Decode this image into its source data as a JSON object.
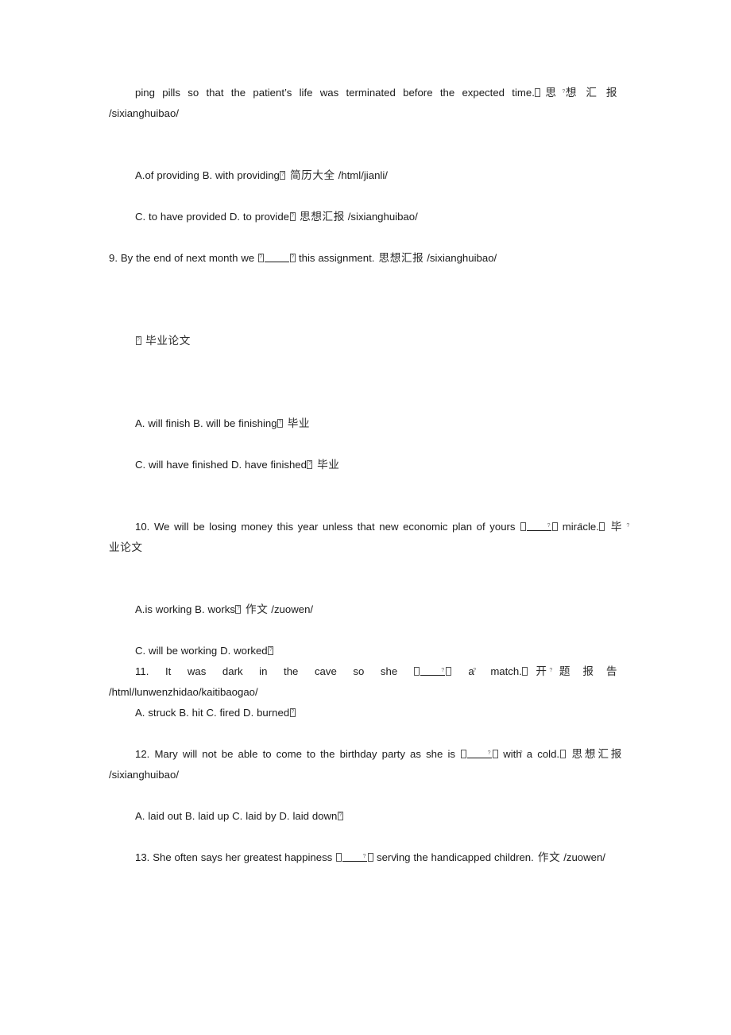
{
  "document": {
    "type": "exam-worksheet",
    "language": "English grammar multiple choice with Chinese watermark links",
    "background_color": "#ffffff",
    "text_color": "#1a1a1a",
    "cjk_color": "#2b2b2b"
  },
  "blocks": [
    {
      "id": "b1",
      "kind": "continuation",
      "indent": true,
      "justify": "hard",
      "runs": [
        {
          "t": "text",
          "v": "ping pills so that the patient’s life was terminated before the expected time."
        },
        {
          "t": "tofu"
        },
        {
          "t": "cjk",
          "v": "思想汇报",
          "wide": true
        },
        {
          "t": "text",
          "v": " /sixianghuibao/"
        }
      ]
    },
    {
      "id": "b2",
      "kind": "options",
      "runs": [
        {
          "t": "text",
          "v": "A.of providing B. with providing"
        },
        {
          "t": "tofu"
        },
        {
          "t": "cjk",
          "v": " 简历大全"
        },
        {
          "t": "text",
          "v": "  /html/jianli/"
        }
      ]
    },
    {
      "id": "b3",
      "kind": "options",
      "runs": [
        {
          "t": "text",
          "v": "C. to have provided D. to provide"
        },
        {
          "t": "tofu"
        },
        {
          "t": "cjk",
          "v": " 思想汇报"
        },
        {
          "t": "text",
          "v": "  /sixianghuibao/"
        }
      ]
    },
    {
      "id": "b4",
      "kind": "question",
      "number": "9",
      "runs": [
        {
          "t": "text",
          "v": "9. By the end of next month we "
        },
        {
          "t": "blank"
        },
        {
          "t": "text",
          "v": " this assignment."
        },
        {
          "t": "cjk",
          "v": "  思想汇报"
        },
        {
          "t": "text",
          "v": "  /sixianghuibao/"
        }
      ]
    },
    {
      "id": "b5",
      "kind": "watermark",
      "runs": [
        {
          "t": "tofu"
        },
        {
          "t": "cjk",
          "v": " 毕业论文"
        }
      ]
    },
    {
      "id": "b6",
      "kind": "options",
      "runs": [
        {
          "t": "text",
          "v": "A. will finish B. will be finishing"
        },
        {
          "t": "tofu"
        },
        {
          "t": "cjk",
          "v": " 毕业"
        }
      ]
    },
    {
      "id": "b7",
      "kind": "options",
      "runs": [
        {
          "t": "text",
          "v": "C. will have finished D. have finished"
        },
        {
          "t": "tofu"
        },
        {
          "t": "cjk",
          "v": " 毕业"
        }
      ]
    },
    {
      "id": "b8",
      "kind": "question",
      "number": "10",
      "indent": true,
      "justify": "hard",
      "spacing": "mid",
      "runs": [
        {
          "t": "text",
          "v": "10. We will be losing money this year unless that new economic plan of yours "
        },
        {
          "t": "blank"
        },
        {
          "t": "text",
          "v": " miracle."
        },
        {
          "t": "tofu"
        },
        {
          "t": "cjk",
          "v": " 毕业论文"
        }
      ]
    },
    {
      "id": "b9",
      "kind": "options",
      "runs": [
        {
          "t": "text",
          "v": "A.is working B. works"
        },
        {
          "t": "tofu"
        },
        {
          "t": "cjk",
          "v": " 作文"
        },
        {
          "t": "text",
          "v": "  /zuowen/"
        }
      ]
    },
    {
      "id": "b10",
      "kind": "options",
      "runs": [
        {
          "t": "text",
          "v": "C. will be working D. worked"
        },
        {
          "t": "tofu"
        }
      ]
    },
    {
      "id": "b11",
      "kind": "question",
      "number": "11",
      "indent": true,
      "justify": "hard",
      "spacing": "loose",
      "runs": [
        {
          "t": "text",
          "v": "11. It was dark in the cave so she "
        },
        {
          "t": "blank"
        },
        {
          "t": "text",
          "v": " a match."
        },
        {
          "t": "tofu"
        },
        {
          "t": "cjk",
          "v": "开题报告",
          "wide": true
        },
        {
          "t": "text",
          "v": " /html/lunwenzhidao/kaitibaogao/"
        }
      ]
    },
    {
      "id": "b12",
      "kind": "options",
      "runs": [
        {
          "t": "text",
          "v": "A. struck B. hit C. fired D. burned"
        },
        {
          "t": "tofu"
        }
      ]
    },
    {
      "id": "b13",
      "kind": "question",
      "number": "12",
      "indent": true,
      "justify": "hard",
      "runs": [
        {
          "t": "text",
          "v": "12. Mary will not be able to come to the birthday party as she is "
        },
        {
          "t": "blank"
        },
        {
          "t": "text",
          "v": " with a cold."
        },
        {
          "t": "tofu"
        },
        {
          "t": "cjk",
          "v": " 思想汇报"
        },
        {
          "t": "text",
          "v": "  /sixianghuibao/"
        }
      ]
    },
    {
      "id": "b14",
      "kind": "options",
      "runs": [
        {
          "t": "text",
          "v": "A. laid out B. laid up C. laid by D. laid down"
        },
        {
          "t": "tofu"
        }
      ]
    },
    {
      "id": "b15",
      "kind": "question",
      "number": "13",
      "indent": true,
      "justify": "hard",
      "runs": [
        {
          "t": "text",
          "v": "13. She often says her greatest happiness "
        },
        {
          "t": "blank"
        },
        {
          "t": "text",
          "v": " serving the handicapped children."
        },
        {
          "t": "cjk",
          "v": "  作文"
        },
        {
          "t": "text",
          "v": " /zuowen/"
        }
      ]
    }
  ],
  "layout": {
    "gaps_after": {
      "b1": "md",
      "b2": "sm",
      "b3": "sm",
      "b4": "lg",
      "b5": "lg",
      "b6": "sm",
      "b7": "md",
      "b8": "md",
      "b9": "sm",
      "b10": "none",
      "b11": "none",
      "b12": "sm",
      "b13": "sm",
      "b14": "sm",
      "b15": "none"
    }
  }
}
